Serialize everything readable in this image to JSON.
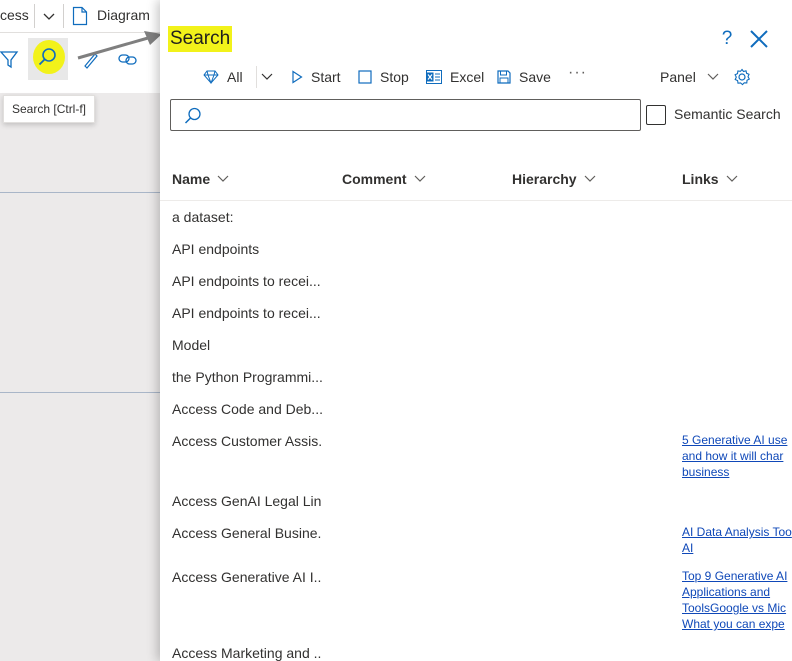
{
  "background_app": {
    "tab_access": "cess",
    "tab_diagram": "Diagram",
    "tooltip": "Search [Ctrl-f]"
  },
  "panel": {
    "title": "Search",
    "toolbar": {
      "all_label": "All",
      "start_label": "Start",
      "stop_label": "Stop",
      "excel_label": "Excel",
      "save_label": "Save",
      "more_label": "···",
      "panel_label": "Panel"
    },
    "search": {
      "value": "",
      "placeholder": ""
    },
    "semantic_search_label": "Semantic Search",
    "columns": [
      "Name",
      "Comment",
      "Hierarchy",
      "Links"
    ],
    "rows": [
      {
        "name": "a dataset:",
        "links": []
      },
      {
        "name": "API endpoints",
        "links": []
      },
      {
        "name": "API endpoints to recei...",
        "links": []
      },
      {
        "name": "API endpoints to recei...",
        "links": []
      },
      {
        "name": "Model",
        "links": []
      },
      {
        "name": "the Python Programmi...",
        "links": []
      },
      {
        "name": "Access Code and Deb...",
        "links": []
      },
      {
        "name": "Access Customer Assis...",
        "links": [
          "5 Generative AI use",
          "and how it will char",
          "business"
        ]
      },
      {
        "name": "Access GenAI Legal Lin...",
        "links": []
      },
      {
        "name": "Access General Busine...",
        "links": [
          "AI Data Analysis Too",
          "AI"
        ]
      },
      {
        "name": "Access Generative AI I...",
        "links": [
          "Top 9 Generative AI",
          "Applications and",
          "ToolsGoogle vs Mic",
          "What you can expe"
        ]
      },
      {
        "name": "Access Marketing and ...",
        "links": []
      }
    ]
  },
  "colors": {
    "highlight": "#f2f21a",
    "accent": "#0f6cbd",
    "link": "#0f48b8"
  }
}
